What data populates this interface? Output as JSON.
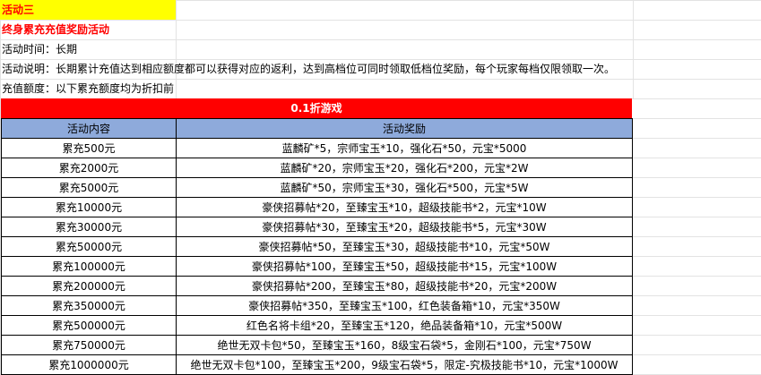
{
  "title": "活动三",
  "subtitle": "终身累充充值奖励活动",
  "info": {
    "time": "活动时间：长期",
    "description": "活动说明：长期累计充值达到相应额度都可以获得对应的返利，达到高档位可同时领取低档位奖励，每个玩家每档仅限领取一次。",
    "amount_note": "充值额度：以下累充额度均为折扣前"
  },
  "banner": "0.1折游戏",
  "table": {
    "headers": [
      "活动内容",
      "活动奖励"
    ],
    "rows": [
      [
        "累充500元",
        "蓝麟矿*5，宗师宝玉*10，强化石*50，元宝*5000"
      ],
      [
        "累充2000元",
        "蓝麟矿*20，宗师宝玉*20，强化石*200，元宝*2W"
      ],
      [
        "累充5000元",
        "蓝麟矿*50，宗师宝玉*30，强化石*500，元宝*5W"
      ],
      [
        "累充10000元",
        "豪侠招募帖*20，至臻宝玉*10，超级技能书*2，元宝*10W"
      ],
      [
        "累充30000元",
        "豪侠招募帖*30，至臻宝玉*20，超级技能书*5，元宝*30W"
      ],
      [
        "累充50000元",
        "豪侠招募帖*50，至臻宝玉*30，超级技能书*10，元宝*50W"
      ],
      [
        "累充100000元",
        "豪侠招募帖*100，至臻宝玉*50，超级技能书*15，元宝*100W"
      ],
      [
        "累充200000元",
        "豪侠招募帖*200，至臻宝玉*80，超级技能书*20，元宝*200W"
      ],
      [
        "累充350000元",
        "豪侠招募帖*350，至臻宝玉*100，红色装备箱*10，元宝*350W"
      ],
      [
        "累充500000元",
        "红色名将卡组*20，至臻宝玉*120，绝品装备箱*10，元宝*500W"
      ],
      [
        "累充750000元",
        "绝世无双卡包*50，至臻宝玉*160，8级宝石袋*5，金刚石*100，元宝*750W"
      ],
      [
        "累充1000000元",
        "绝世无双卡包*100，至臻宝玉*200，9级宝石袋*5，限定-究极技能书*10，元宝*1000W"
      ]
    ]
  }
}
